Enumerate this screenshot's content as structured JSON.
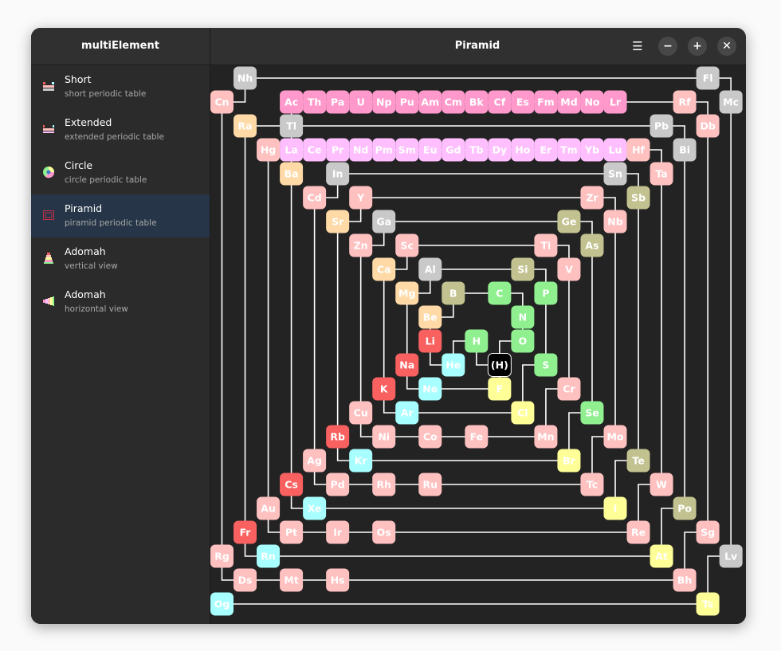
{
  "app": {
    "title": "multiElement"
  },
  "header": {
    "title": "Piramid"
  },
  "sidebar": {
    "items": [
      {
        "label": "Short",
        "sub": "short periodic table",
        "icon": "short-table-icon"
      },
      {
        "label": "Extended",
        "sub": "extended periodic table",
        "icon": "extended-table-icon"
      },
      {
        "label": "Circle",
        "sub": "circle periodic table",
        "icon": "circle-table-icon"
      },
      {
        "label": "Piramid",
        "sub": "piramid periodic table",
        "icon": "piramid-table-icon"
      },
      {
        "label": "Adomah",
        "sub": "vertical view",
        "icon": "adomah-vertical-icon"
      },
      {
        "label": "Adomah",
        "sub": "horizontal view",
        "icon": "adomah-horizontal-icon"
      }
    ]
  },
  "colors": {
    "s_block": "#f96060",
    "s_block2": "#ffd9a6",
    "p_metal": "#c9c9c9",
    "metalloid": "#c2c290",
    "nonmetal": "#90f090",
    "halogen": "#ffff98",
    "noble": "#a8ffff",
    "d_block": "#ffc0c0",
    "lanthanide": "#ffbfff",
    "actinide": "#ff99cc",
    "hydrogen_special": "#000000"
  },
  "elements": [
    {
      "sym": "(H)",
      "t": "hs"
    },
    {
      "sym": "H",
      "t": "nm"
    },
    {
      "sym": "He",
      "t": "ng"
    },
    {
      "sym": "Li",
      "t": "al"
    },
    {
      "sym": "Be",
      "t": "ae"
    },
    {
      "sym": "B",
      "t": "md"
    },
    {
      "sym": "C",
      "t": "nm"
    },
    {
      "sym": "N",
      "t": "nm"
    },
    {
      "sym": "O",
      "t": "nm"
    },
    {
      "sym": "F",
      "t": "ha"
    },
    {
      "sym": "Ne",
      "t": "ng"
    },
    {
      "sym": "Na",
      "t": "al"
    },
    {
      "sym": "Mg",
      "t": "ae"
    },
    {
      "sym": "Al",
      "t": "pm"
    },
    {
      "sym": "Si",
      "t": "md"
    },
    {
      "sym": "P",
      "t": "nm"
    },
    {
      "sym": "S",
      "t": "nm"
    },
    {
      "sym": "Cl",
      "t": "ha"
    },
    {
      "sym": "Ar",
      "t": "ng"
    },
    {
      "sym": "K",
      "t": "al"
    },
    {
      "sym": "Ca",
      "t": "ae"
    },
    {
      "sym": "Sc",
      "t": "tm"
    },
    {
      "sym": "Ti",
      "t": "tm"
    },
    {
      "sym": "V",
      "t": "tm"
    },
    {
      "sym": "Cr",
      "t": "tm"
    },
    {
      "sym": "Mn",
      "t": "tm"
    },
    {
      "sym": "Fe",
      "t": "tm"
    },
    {
      "sym": "Co",
      "t": "tm"
    },
    {
      "sym": "Ni",
      "t": "tm"
    },
    {
      "sym": "Cu",
      "t": "tm"
    },
    {
      "sym": "Zn",
      "t": "tm"
    },
    {
      "sym": "Ga",
      "t": "pm"
    },
    {
      "sym": "Ge",
      "t": "md"
    },
    {
      "sym": "As",
      "t": "md"
    },
    {
      "sym": "Se",
      "t": "nm"
    },
    {
      "sym": "Br",
      "t": "ha"
    },
    {
      "sym": "Kr",
      "t": "ng"
    },
    {
      "sym": "Rb",
      "t": "al"
    },
    {
      "sym": "Sr",
      "t": "ae"
    },
    {
      "sym": "Y",
      "t": "tm"
    },
    {
      "sym": "Zr",
      "t": "tm"
    },
    {
      "sym": "Nb",
      "t": "tm"
    },
    {
      "sym": "Mo",
      "t": "tm"
    },
    {
      "sym": "Tc",
      "t": "tm"
    },
    {
      "sym": "Ru",
      "t": "tm"
    },
    {
      "sym": "Rh",
      "t": "tm"
    },
    {
      "sym": "Pd",
      "t": "tm"
    },
    {
      "sym": "Ag",
      "t": "tm"
    },
    {
      "sym": "Cd",
      "t": "tm"
    },
    {
      "sym": "In",
      "t": "pm"
    },
    {
      "sym": "Sn",
      "t": "pm"
    },
    {
      "sym": "Sb",
      "t": "md"
    },
    {
      "sym": "Te",
      "t": "md"
    },
    {
      "sym": "I",
      "t": "ha"
    },
    {
      "sym": "Xe",
      "t": "ng"
    },
    {
      "sym": "Cs",
      "t": "al"
    },
    {
      "sym": "Ba",
      "t": "ae"
    },
    {
      "sym": "La",
      "t": "la"
    },
    {
      "sym": "Ce",
      "t": "la"
    },
    {
      "sym": "Pr",
      "t": "la"
    },
    {
      "sym": "Nd",
      "t": "la"
    },
    {
      "sym": "Pm",
      "t": "la"
    },
    {
      "sym": "Sm",
      "t": "la"
    },
    {
      "sym": "Eu",
      "t": "la"
    },
    {
      "sym": "Gd",
      "t": "la"
    },
    {
      "sym": "Tb",
      "t": "la"
    },
    {
      "sym": "Dy",
      "t": "la"
    },
    {
      "sym": "Ho",
      "t": "la"
    },
    {
      "sym": "Er",
      "t": "la"
    },
    {
      "sym": "Tm",
      "t": "la"
    },
    {
      "sym": "Yb",
      "t": "la"
    },
    {
      "sym": "Lu",
      "t": "la"
    },
    {
      "sym": "Hf",
      "t": "tm"
    },
    {
      "sym": "Ta",
      "t": "tm"
    },
    {
      "sym": "W",
      "t": "tm"
    },
    {
      "sym": "Re",
      "t": "tm"
    },
    {
      "sym": "Os",
      "t": "tm"
    },
    {
      "sym": "Ir",
      "t": "tm"
    },
    {
      "sym": "Pt",
      "t": "tm"
    },
    {
      "sym": "Au",
      "t": "tm"
    },
    {
      "sym": "Hg",
      "t": "tm"
    },
    {
      "sym": "Tl",
      "t": "pm"
    },
    {
      "sym": "Pb",
      "t": "pm"
    },
    {
      "sym": "Bi",
      "t": "pm"
    },
    {
      "sym": "Po",
      "t": "md"
    },
    {
      "sym": "At",
      "t": "ha"
    },
    {
      "sym": "Rn",
      "t": "ng"
    },
    {
      "sym": "Fr",
      "t": "al"
    },
    {
      "sym": "Ra",
      "t": "ae"
    },
    {
      "sym": "Ac",
      "t": "ac"
    },
    {
      "sym": "Th",
      "t": "ac"
    },
    {
      "sym": "Pa",
      "t": "ac"
    },
    {
      "sym": "U",
      "t": "ac"
    },
    {
      "sym": "Np",
      "t": "ac"
    },
    {
      "sym": "Pu",
      "t": "ac"
    },
    {
      "sym": "Am",
      "t": "ac"
    },
    {
      "sym": "Cm",
      "t": "ac"
    },
    {
      "sym": "Bk",
      "t": "ac"
    },
    {
      "sym": "Cf",
      "t": "ac"
    },
    {
      "sym": "Es",
      "t": "ac"
    },
    {
      "sym": "Fm",
      "t": "ac"
    },
    {
      "sym": "Md",
      "t": "ac"
    },
    {
      "sym": "No",
      "t": "ac"
    },
    {
      "sym": "Lr",
      "t": "ac"
    },
    {
      "sym": "Rf",
      "t": "tm"
    },
    {
      "sym": "Db",
      "t": "tm"
    },
    {
      "sym": "Sg",
      "t": "tm"
    },
    {
      "sym": "Bh",
      "t": "tm"
    },
    {
      "sym": "Hs",
      "t": "tm"
    },
    {
      "sym": "Mt",
      "t": "tm"
    },
    {
      "sym": "Ds",
      "t": "tm"
    },
    {
      "sym": "Rg",
      "t": "tm"
    },
    {
      "sym": "Cn",
      "t": "tm"
    },
    {
      "sym": "Nh",
      "t": "pm"
    },
    {
      "sym": "Fl",
      "t": "pm"
    },
    {
      "sym": "Mc",
      "t": "pm"
    },
    {
      "sym": "Lv",
      "t": "pm"
    },
    {
      "sym": "Ts",
      "t": "ha"
    },
    {
      "sym": "Og",
      "t": "ng"
    }
  ]
}
